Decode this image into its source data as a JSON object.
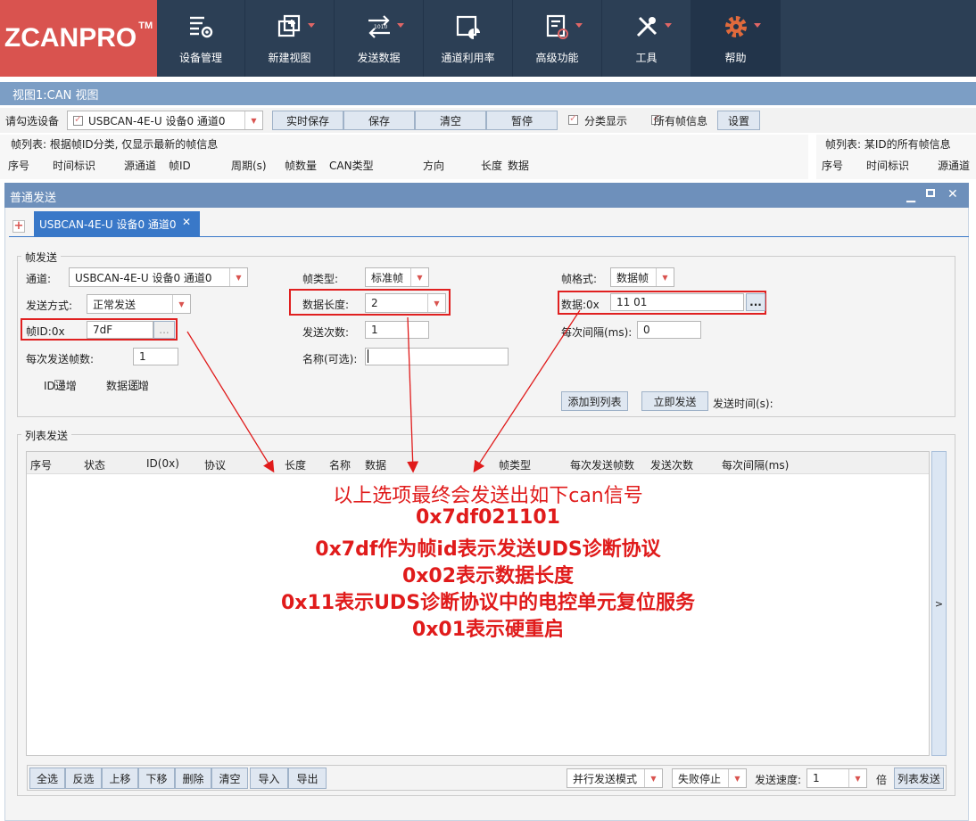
{
  "app": {
    "logo": "ZCANPRO",
    "tm": "TM"
  },
  "toolbar": [
    {
      "label": "设备管理",
      "icon": "device-gear-icon"
    },
    {
      "label": "新建视图",
      "icon": "new-view-icon"
    },
    {
      "label": "发送数据",
      "icon": "send-data-icon"
    },
    {
      "label": "通道利用率",
      "icon": "channel-usage-icon"
    },
    {
      "label": "高级功能",
      "icon": "advanced-icon"
    },
    {
      "label": "工具",
      "icon": "tools-icon"
    },
    {
      "label": "帮助",
      "icon": "help-gear-icon"
    }
  ],
  "view": {
    "title": "视图1:CAN 视图"
  },
  "select_row": {
    "label": "请勾选设备",
    "device": "USBCAN-4E-U 设备0 通道0",
    "buttons": [
      "实时保存",
      "保存",
      "清空",
      "暂停"
    ],
    "check1": "分类显示",
    "check2": "所有帧信息",
    "settings": "设置"
  },
  "frame_list_left": {
    "title": "帧列表: 根据帧ID分类, 仅显示最新的帧信息",
    "columns": [
      "序号",
      "时间标识",
      "源通道",
      "帧ID",
      "周期(s)",
      "帧数量",
      "CAN类型",
      "方向",
      "长度",
      "数据"
    ]
  },
  "frame_list_right": {
    "title": "帧列表: 某ID的所有帧信息",
    "columns": [
      "序号",
      "时间标识",
      "源通道"
    ]
  },
  "send": {
    "title": "普通发送",
    "tab": "USBCAN-4E-U 设备0 通道0",
    "group": "帧发送",
    "channel_label": "通道:",
    "channel_value": "USBCAN-4E-U 设备0 通道0",
    "mode_label": "发送方式:",
    "mode_value": "正常发送",
    "id_label": "帧ID:0x",
    "id_value": "7dF",
    "per_label": "每次发送帧数:",
    "per_value": "1",
    "id_inc": "ID递增",
    "data_inc": "数据递增",
    "type_label": "帧类型:",
    "type_value": "标准帧",
    "len_label": "数据长度:",
    "len_value": "2",
    "count_label": "发送次数:",
    "count_value": "1",
    "name_label": "名称(可选):",
    "name_value": "",
    "format_label": "帧格式:",
    "format_value": "数据帧",
    "data_label": "数据:0x",
    "data_value": "11 01",
    "interval_label": "每次间隔(ms):",
    "interval_value": "0",
    "add_btn": "添加到列表",
    "send_btn": "立即发送",
    "send_time": "发送时间(s):",
    "dots": "..."
  },
  "list": {
    "group": "列表发送",
    "columns": [
      "序号",
      "状态",
      "ID(0x)",
      "协议",
      "长度",
      "名称",
      "数据",
      "帧类型",
      "每次发送帧数",
      "发送次数",
      "每次间隔(ms)"
    ],
    "scroll": ">",
    "buttons": [
      "全选",
      "反选",
      "上移",
      "下移",
      "删除",
      "清空",
      "导入",
      "导出"
    ],
    "mode": "并行发送模式",
    "fail": "失败停止",
    "speed_label": "发送速度:",
    "speed_value": "1",
    "times": "倍",
    "list_send": "列表发送"
  },
  "annotation": [
    "以上选项最终会发送出如下can信号",
    "0x7df021101",
    "0x7df作为帧id表示发送UDS诊断协议",
    "0x02表示数据长度",
    "0x11表示UDS诊断协议中的电控单元复位服务",
    "0x01表示硬重启"
  ]
}
